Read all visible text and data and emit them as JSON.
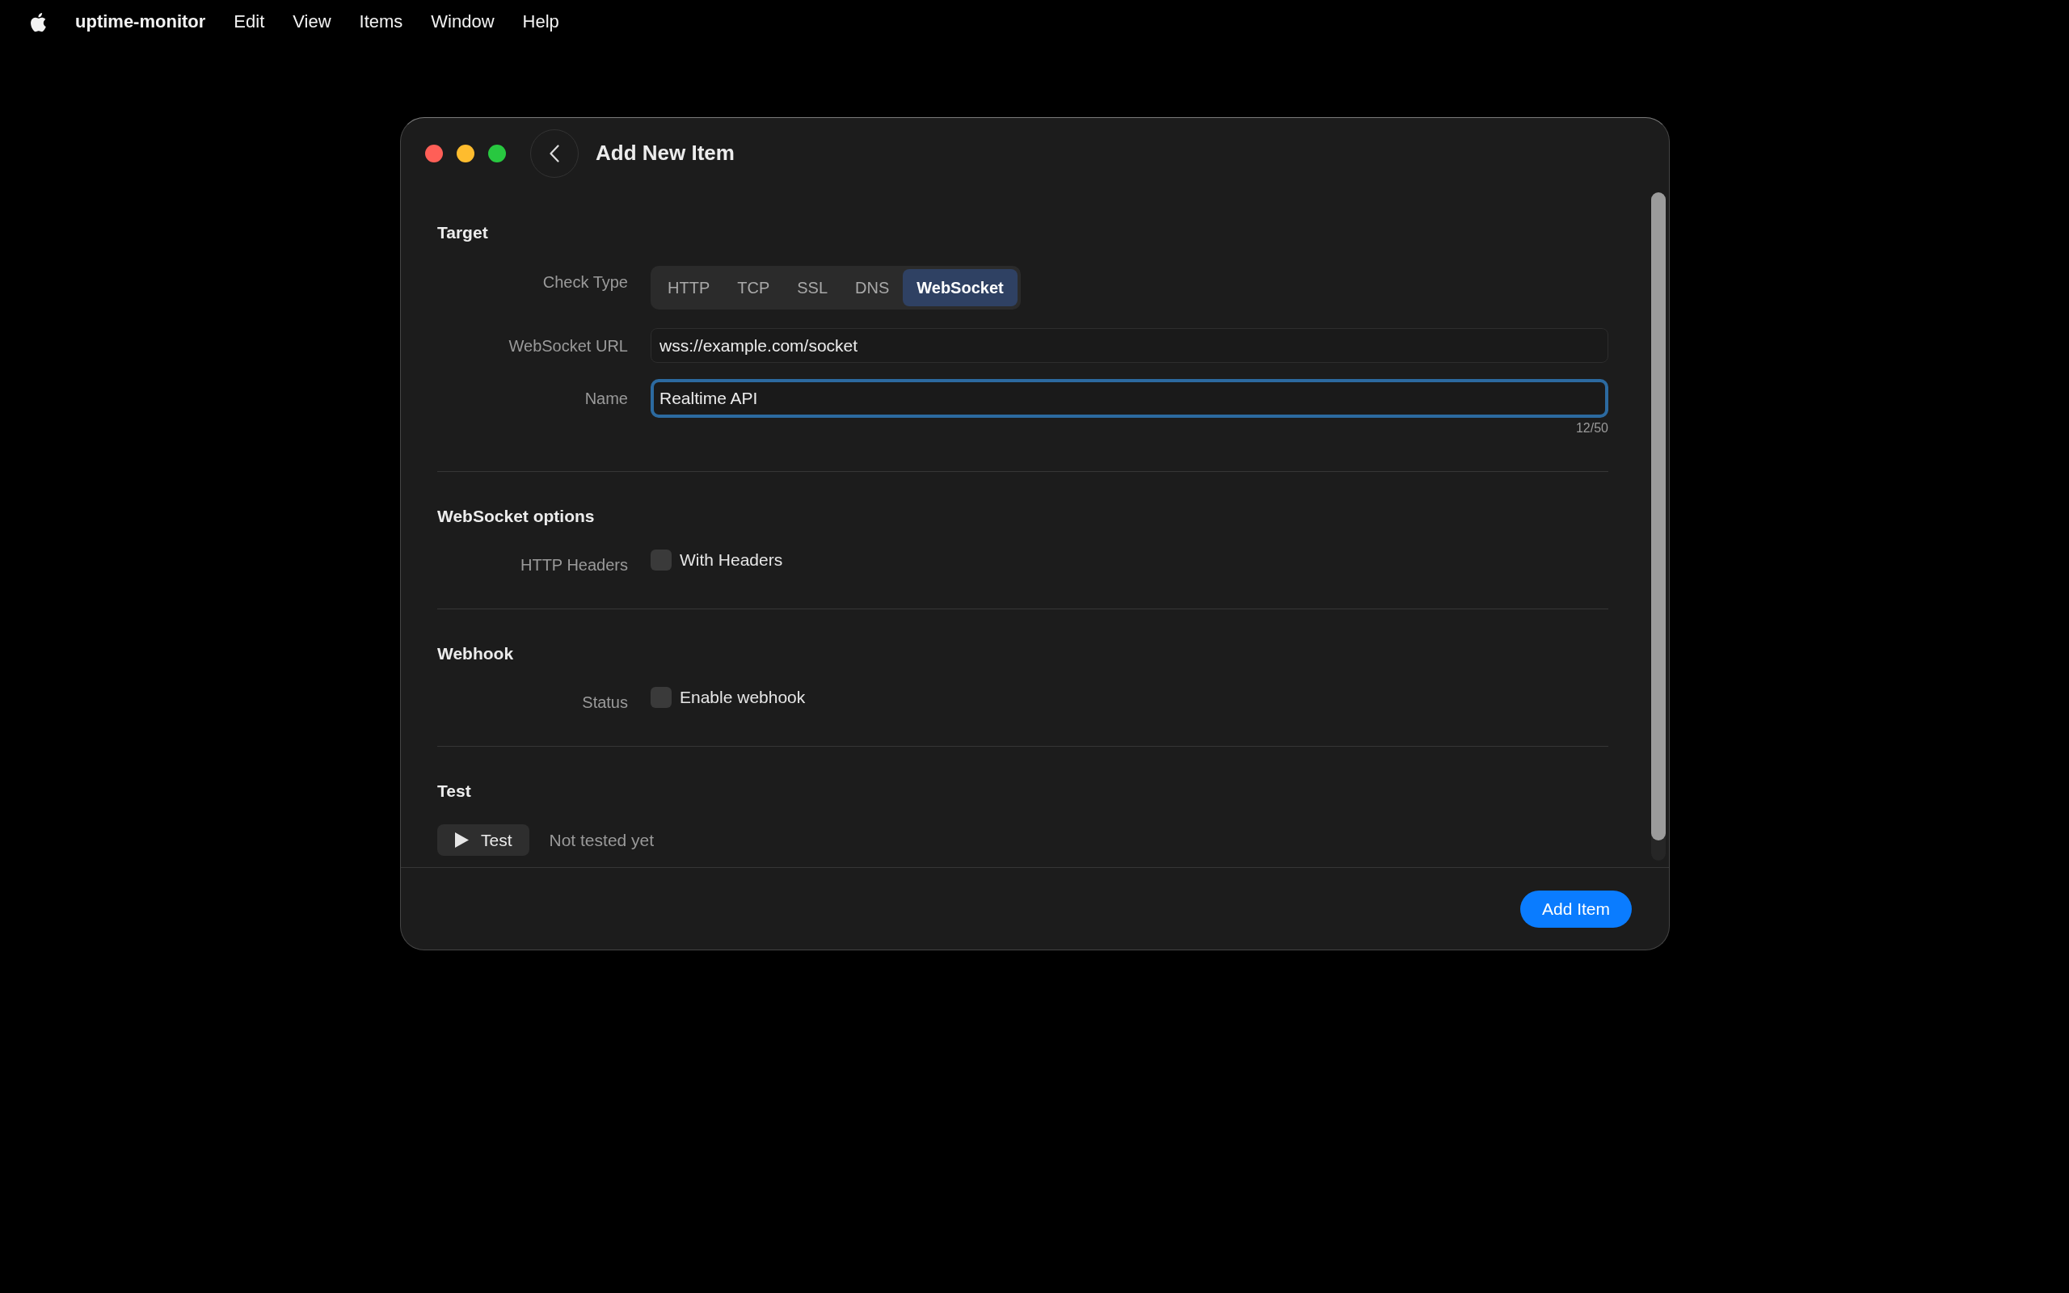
{
  "menu_bar": {
    "app_name": "uptime-monitor",
    "items": [
      "Edit",
      "View",
      "Items",
      "Window",
      "Help"
    ]
  },
  "window": {
    "title": "Add New Item"
  },
  "sections": [
    {
      "title": "Target",
      "rows": [
        {
          "kind": "segmented",
          "label": "Check Type",
          "options": [
            {
              "label": "HTTP",
              "selected": false
            },
            {
              "label": "TCP",
              "selected": false
            },
            {
              "label": "SSL",
              "selected": false
            },
            {
              "label": "DNS",
              "selected": false
            },
            {
              "label": "WebSocket",
              "selected": true
            }
          ]
        },
        {
          "kind": "text",
          "label": "WebSocket URL",
          "value": "wss://example.com/socket",
          "focused": false
        },
        {
          "kind": "text",
          "label": "Name",
          "value": "Realtime API",
          "focused": true,
          "counter": "12/50"
        }
      ]
    },
    {
      "title": "WebSocket options",
      "rows": [
        {
          "kind": "checkbox",
          "label": "HTTP Headers",
          "text": "With Headers",
          "checked": false
        }
      ]
    },
    {
      "title": "Webhook",
      "rows": [
        {
          "kind": "checkbox",
          "label": "Status",
          "text": "Enable webhook",
          "checked": false
        }
      ]
    },
    {
      "title": "Test",
      "rows": [
        {
          "kind": "test",
          "button": "Test",
          "status": "Not tested yet"
        }
      ]
    }
  ],
  "footer": {
    "primary_button": "Add Item"
  }
}
